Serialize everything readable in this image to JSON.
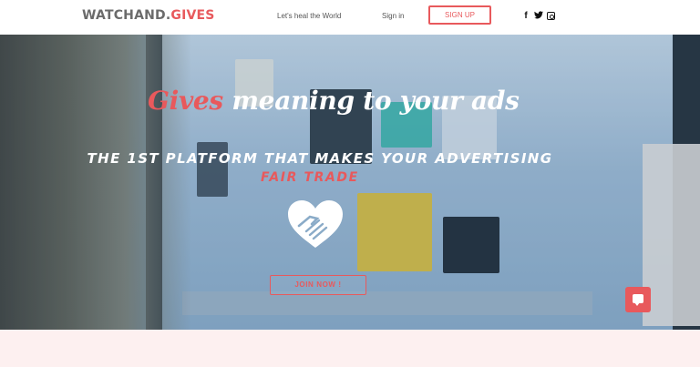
{
  "header": {
    "logo_part1": "WATCHAND.",
    "logo_part2": "GIVES",
    "nav_heal": "Let's heal the World",
    "nav_signin": "Sign in",
    "signup_label": "SIGN UP",
    "social": [
      "facebook-icon",
      "twitter-icon",
      "instagram-icon"
    ]
  },
  "hero": {
    "headline_accent": "Gives",
    "headline_rest": " meaning to your ads",
    "subline": "THE 1ST PLATFORM THAT MAKES YOUR ADVERTISING",
    "subline_accent": "FAIR TRADE",
    "join_label": "JOIN NOW !"
  },
  "colors": {
    "accent": "#e8595c",
    "text_gray": "#6b6b6b",
    "bottom_strip": "#fdf0f0"
  }
}
